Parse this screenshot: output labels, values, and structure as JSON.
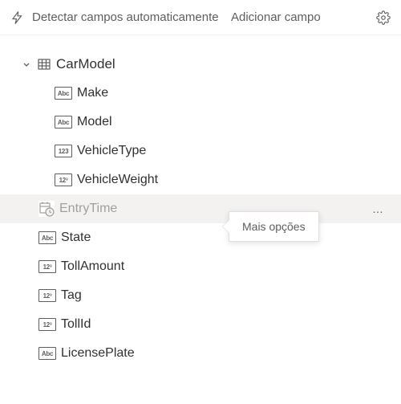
{
  "toolbar": {
    "detect_label": "Detectar campos automaticamente",
    "add_field_label": "Adicionar campo",
    "bolt_icon": "bolt-icon",
    "gear_icon": "gear-icon"
  },
  "tree": {
    "root": {
      "label": "CarModel",
      "icon": "table-icon"
    },
    "nested_fields": [
      {
        "label": "Make",
        "type_text": "Abc",
        "type": "text"
      },
      {
        "label": "Model",
        "type_text": "Abc",
        "type": "text"
      },
      {
        "label": "VehicleType",
        "type_text": "123",
        "type": "number"
      },
      {
        "label": "VehicleWeight",
        "type_text": "12³",
        "type": "decimal"
      }
    ],
    "selected_field": {
      "label": "EntryTime",
      "type": "datetime"
    },
    "flat_fields": [
      {
        "label": "State",
        "type_text": "Abc",
        "type": "text",
        "cutoff": true
      },
      {
        "label": "TollAmount",
        "type_text": "12³",
        "type": "decimal"
      },
      {
        "label": "Tag",
        "type_text": "12³",
        "type": "decimal"
      },
      {
        "label": "TollId",
        "type_text": "12³",
        "type": "decimal"
      },
      {
        "label": "LicensePlate",
        "type_text": "Abc",
        "type": "text"
      }
    ]
  },
  "tooltip": {
    "label": "Mais opções"
  },
  "icons": {
    "more": "…"
  }
}
